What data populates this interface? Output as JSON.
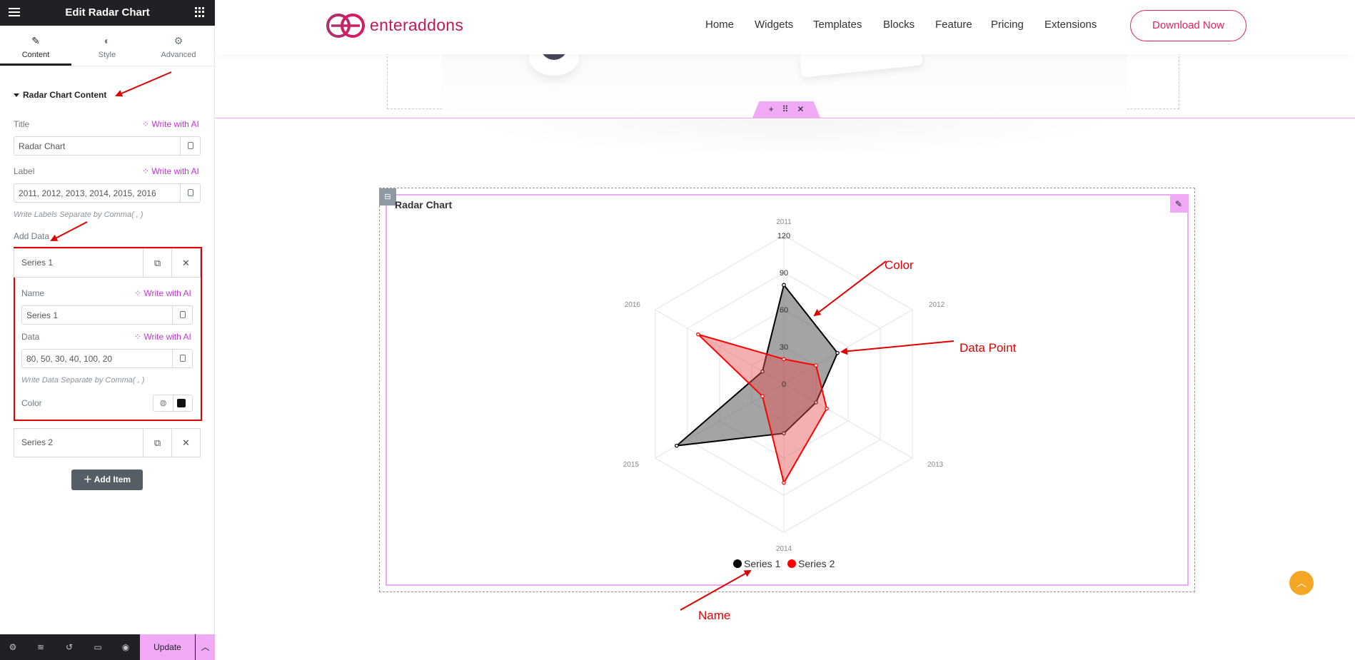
{
  "panel": {
    "header_title": "Edit Radar Chart",
    "tabs": [
      {
        "label": "Content",
        "icon": "pencil-icon"
      },
      {
        "label": "Style",
        "icon": "half-circle-icon"
      },
      {
        "label": "Advanced",
        "icon": "gear-icon"
      }
    ],
    "section_title": "Radar Chart Content",
    "title_label": "Title",
    "write_ai": "Write with AI",
    "title_value": "Radar Chart",
    "label_label": "Label",
    "label_value": "2011, 2012, 2013, 2014, 2015, 2016",
    "label_hint": "Write Labels Separate by Comma( , )",
    "add_data_label": "Add Data",
    "series1": {
      "title": "Series 1",
      "name_label": "Name",
      "name_value": "Series 1",
      "data_label": "Data",
      "data_value": "80, 50, 30, 40, 100, 20",
      "data_hint": "Write Data Separate by Comma( , )",
      "color_label": "Color",
      "color": "#111111"
    },
    "series2": {
      "title": "Series 2"
    },
    "add_item": "Add Item",
    "update": "Update"
  },
  "site": {
    "logo": "enteraddons",
    "nav": [
      "Home",
      "Widgets",
      "Templates",
      "Blocks",
      "Feature",
      "Pricing",
      "Extensions"
    ],
    "download": "Download Now",
    "accent": "#e0245e"
  },
  "annotations": {
    "color": "Color",
    "data_point": "Data Point",
    "name": "Name"
  },
  "chart_data": {
    "type": "radar",
    "title": "Radar Chart",
    "labels": [
      "2011",
      "2012",
      "2013",
      "2014",
      "2015",
      "2016"
    ],
    "scale_ticks": [
      0,
      30,
      60,
      90,
      120
    ],
    "range": [
      0,
      120
    ],
    "legend_position": "bottom",
    "series": [
      {
        "name": "Series 1",
        "values": [
          80,
          50,
          30,
          40,
          100,
          20
        ],
        "color": "#000000"
      },
      {
        "name": "Series 2",
        "values": [
          20,
          30,
          40,
          80,
          20,
          80
        ],
        "color": "#ff0000"
      }
    ]
  }
}
